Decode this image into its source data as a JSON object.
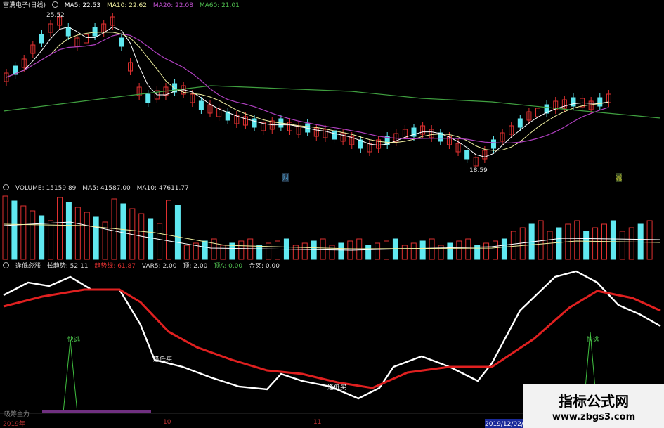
{
  "price_panel": {
    "stock_title": "富满电子(日线)",
    "ma5_label": "MA5: 22.53",
    "ma10_label": "MA10: 22.62",
    "ma20_label": "MA20: 22.08",
    "ma60_label": "MA60: 21.01",
    "high_label": "25.52",
    "low_label": "18.59",
    "marker_cai": "财",
    "marker_jian": "减",
    "colors": {
      "ma5": "#ffffff",
      "ma10": "#f0f0a0",
      "ma20": "#b040c0",
      "ma60": "#40a040",
      "up": "#e03030",
      "down": "#60e8f0"
    }
  },
  "volume_panel": {
    "volume_label": "VOLUME: 15159.89",
    "ma5_label": "MA5: 41587.00",
    "ma10_label": "MA10: 47611.77"
  },
  "indicator_panel": {
    "name": "逢低必涨",
    "long_trend_label": "长趋势: 52.11",
    "trend_line_label": "趋势线: 61.87",
    "var_label": "VAR5: 2.00",
    "top_label": "顶: 2.00",
    "top_a_label": "顶A: 0.00",
    "golden_cross_label": "金叉: 0.00",
    "tag_fast_1": "快逃",
    "tag_fast_2": "快逃",
    "tag_buy_1": "逢低买",
    "tag_buy_2": "逢低买",
    "bottom_text": "吸筹主力",
    "colors": {
      "white_line": "#ffffff",
      "red_line": "#e02020",
      "signal": "#40c040"
    }
  },
  "x_axis": {
    "labels": [
      "2019年",
      "10",
      "11",
      "2019/12/02/一"
    ]
  },
  "watermark": {
    "title": "指标公式网",
    "url": "www.zbgs3.com"
  }
}
